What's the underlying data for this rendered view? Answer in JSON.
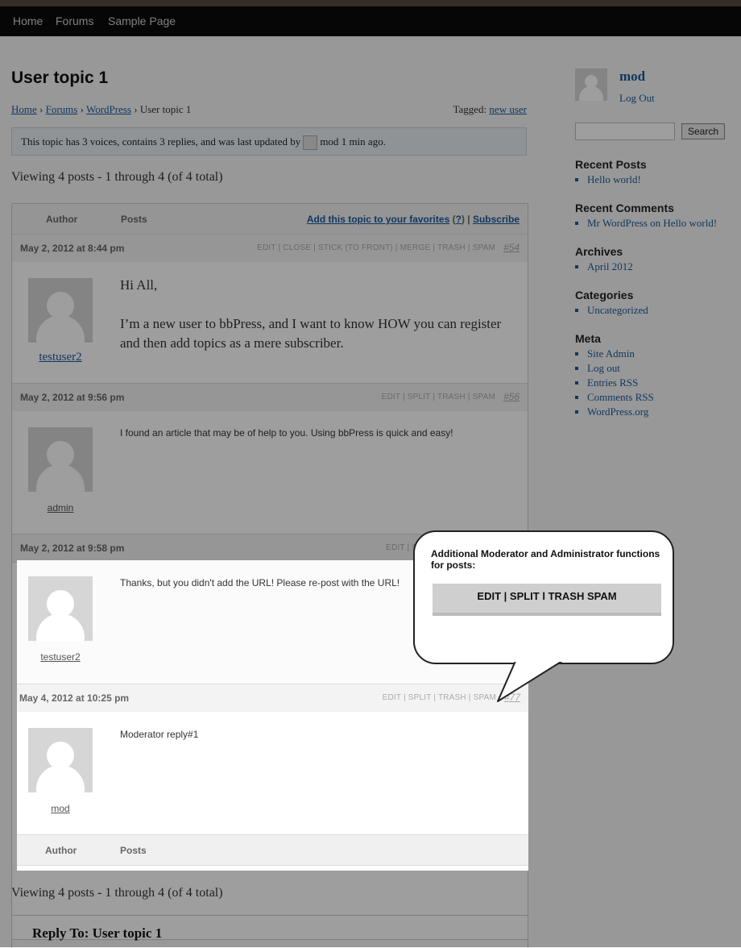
{
  "nav": [
    "Home",
    "Forums",
    "Sample Page"
  ],
  "page_title": "User topic 1",
  "breadcrumb": {
    "home": "Home",
    "forums": "Forums",
    "forum": "WordPress",
    "sep": "›",
    "current": "User topic 1"
  },
  "tagged": {
    "label": "Tagged:",
    "tag": "new user"
  },
  "topic_info": {
    "prefix": "This topic has 3 voices, contains 3 replies, and was last updated by",
    "user": "mod",
    "time": "1 min",
    "suffix": "ago."
  },
  "viewing": "Viewing 4 posts - 1 through 4 (of 4 total)",
  "table_header": {
    "author": "Author",
    "posts": "Posts",
    "favorites": "Add this topic to your favorites",
    "help": "?",
    "subscribe": "Subscribe"
  },
  "posts": [
    {
      "date": "May 2, 2012 at 8:44 pm",
      "admin_links": "EDIT | CLOSE | STICK (TO FRONT) | MERGE | TRASH | SPAM",
      "permalink": "#54",
      "author": "testuser2",
      "content_p1": "Hi All,",
      "content_p2": "I’m a new user to bbPress, and I want to know HOW you can register and then add topics as a mere subscriber."
    },
    {
      "date": "May 2, 2012 at 9:56 pm",
      "admin_links": "EDIT | SPLIT | TRASH | SPAM",
      "permalink": "#56",
      "author": "admin",
      "content": "I found an article that may be of help to you. Using bbPress is quick and easy!"
    },
    {
      "date": "May 2, 2012 at 9:58 pm",
      "admin_links": "EDIT | SP",
      "author": "testuser2",
      "content": "Thanks, but you didn't add the URL! Please re-post with the URL!"
    },
    {
      "date": "May 4, 2012 at 10:25 pm",
      "admin_links": "EDIT | SPLIT | TRASH | SPAM",
      "permalink": "#77",
      "author": "mod",
      "content": "Moderator reply#1"
    }
  ],
  "callout": {
    "title": "Additional  Moderator and Administrator functions for posts:",
    "bar": "EDIT  |  SPLIT l TRASH SPAM"
  },
  "reply_title": "Reply To: User topic 1",
  "sidebar": {
    "user": "mod",
    "logout": "Log Out",
    "search_button": "Search",
    "widgets": [
      {
        "title": "Recent Posts",
        "items": [
          "Hello world!"
        ]
      },
      {
        "title": "Recent Comments",
        "items": [
          "Mr WordPress on Hello world!"
        ]
      },
      {
        "title": "Archives",
        "items": [
          "April 2012"
        ]
      },
      {
        "title": "Categories",
        "items": [
          "Uncategorized"
        ]
      },
      {
        "title": "Meta",
        "items": [
          "Site Admin",
          "Log out",
          "Entries RSS",
          "Comments RSS",
          "WordPress.org"
        ]
      }
    ]
  }
}
